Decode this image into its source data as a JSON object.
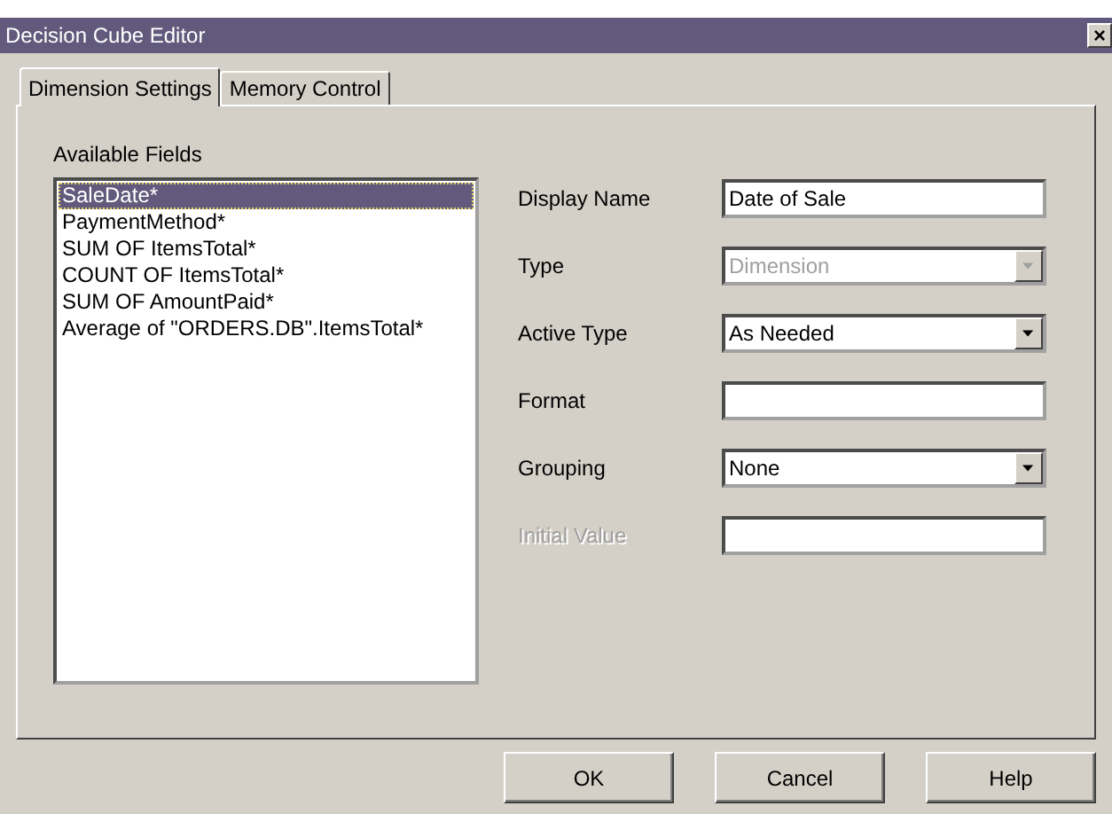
{
  "window": {
    "title": "Decision Cube Editor",
    "close": "×"
  },
  "tabs": [
    {
      "label": "Dimension Settings",
      "selected": true
    },
    {
      "label": "Memory Control",
      "selected": false
    }
  ],
  "available_fields": {
    "label": "Available Fields",
    "items": [
      {
        "label": "SaleDate*",
        "selected": true
      },
      {
        "label": "PaymentMethod*",
        "selected": false
      },
      {
        "label": "SUM OF ItemsTotal*",
        "selected": false
      },
      {
        "label": "COUNT OF ItemsTotal*",
        "selected": false
      },
      {
        "label": "SUM OF AmountPaid*",
        "selected": false
      },
      {
        "label": "Average of \"ORDERS.DB\".ItemsTotal*",
        "selected": false
      }
    ]
  },
  "settings": [
    {
      "label": "Display Name",
      "label_disabled": false,
      "kind": "text",
      "value": "Date of Sale",
      "disabled": false
    },
    {
      "label": "Type",
      "label_disabled": false,
      "kind": "combo",
      "value": "Dimension",
      "disabled": true
    },
    {
      "label": "Active Type",
      "label_disabled": false,
      "kind": "combo",
      "value": "As Needed",
      "disabled": false
    },
    {
      "label": "Format",
      "label_disabled": false,
      "kind": "text",
      "disabled": false
    },
    {
      "label": "Grouping",
      "label_disabled": false,
      "kind": "combo",
      "value": "None",
      "disabled": false
    },
    {
      "label": "Initial Value",
      "label_disabled": true,
      "kind": "text",
      "disabled": false
    }
  ],
  "buttons": [
    "OK",
    "Cancel",
    "Help"
  ]
}
